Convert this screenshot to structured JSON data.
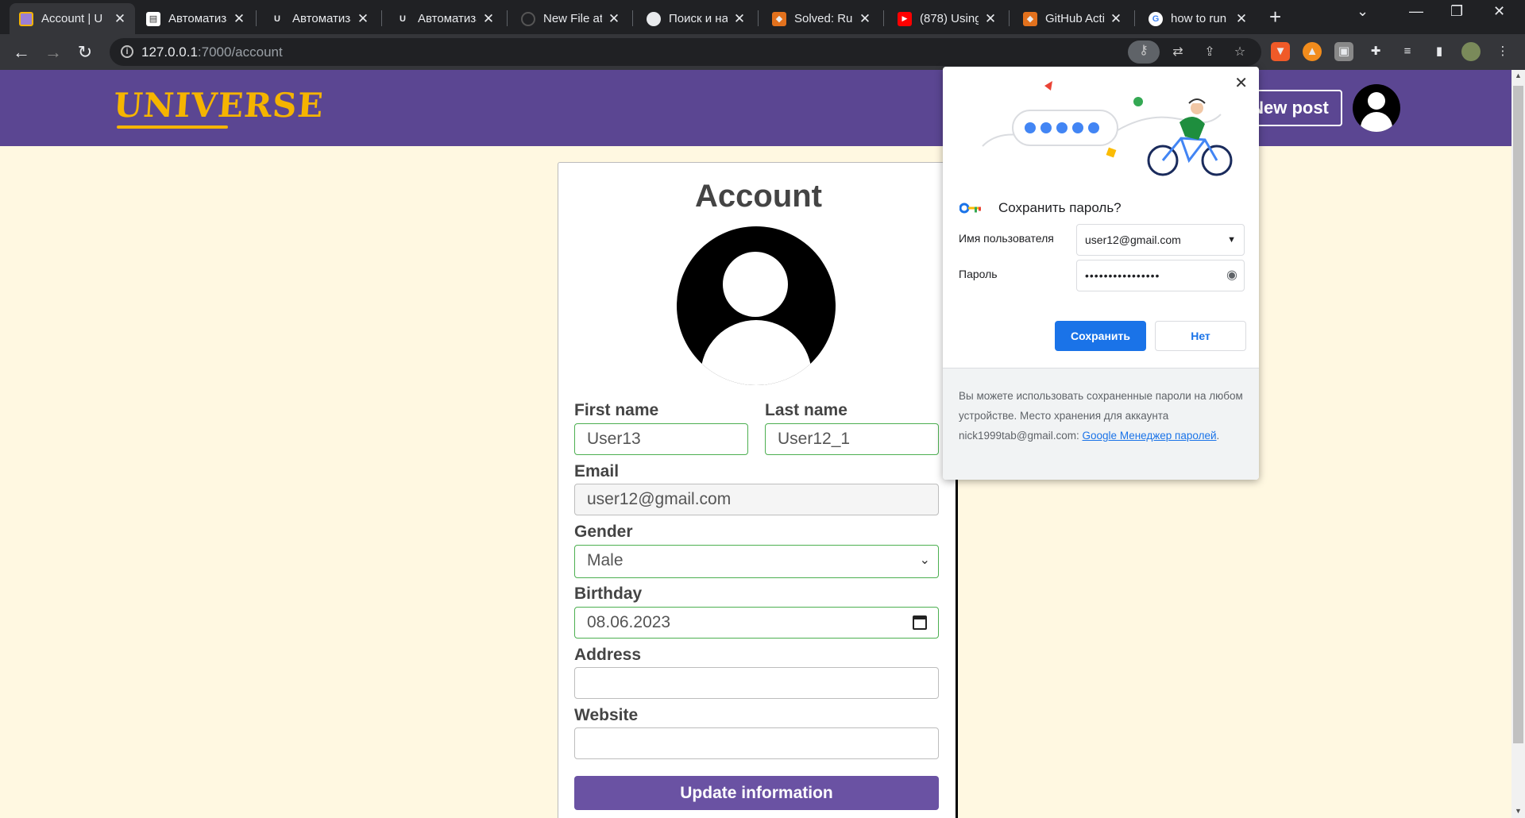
{
  "browser": {
    "tabs": [
      {
        "title": "Account | U",
        "active": true,
        "favicon": "universe-favicon"
      },
      {
        "title": "Автоматиза",
        "favicon": "doc-favicon"
      },
      {
        "title": "Автоматиза",
        "favicon": "umk-favicon"
      },
      {
        "title": "Автоматиза",
        "favicon": "umk-favicon"
      },
      {
        "title": "New File at",
        "favicon": "github-favicon"
      },
      {
        "title": "Поиск и на",
        "favicon": "github-favicon"
      },
      {
        "title": "Solved: Run",
        "favicon": "gitlab-favicon"
      },
      {
        "title": "(878) Using",
        "favicon": "youtube-favicon"
      },
      {
        "title": "GitHub Acti",
        "favicon": "gitlab-favicon"
      },
      {
        "title": "how to run",
        "favicon": "google-favicon"
      }
    ],
    "url_host": "127.0.0.1",
    "url_rest": ":7000/account"
  },
  "site": {
    "logo": "UNIVERSE",
    "new_post": "New post"
  },
  "account": {
    "title": "Account",
    "first_name_label": "First name",
    "first_name": "User13",
    "last_name_label": "Last name",
    "last_name": "User12_1",
    "email_label": "Email",
    "email": "user12@gmail.com",
    "gender_label": "Gender",
    "gender": "Male",
    "birthday_label": "Birthday",
    "birthday": "08.06.2023",
    "address_label": "Address",
    "address": "",
    "website_label": "Website",
    "website": "",
    "update_button": "Update information"
  },
  "password_popup": {
    "title": "Сохранить пароль?",
    "username_label": "Имя пользователя",
    "username": "user12@gmail.com",
    "password_label": "Пароль",
    "password_masked": "••••••••••••••••",
    "save_button": "Сохранить",
    "no_button": "Нет",
    "footer_text": "Вы можете использовать сохраненные пароли на любом устройстве. Место хранения для аккаунта nick1999tab@gmail.com: ",
    "footer_link": "Google Менеджер паролей",
    "footer_end": "."
  },
  "colors": {
    "header_bg": "#5b4692",
    "page_bg": "#fff8e1",
    "logo": "#f5b400",
    "button": "#6a52a3",
    "focus_green": "#4caf50",
    "chrome_blue": "#1a73e8"
  }
}
